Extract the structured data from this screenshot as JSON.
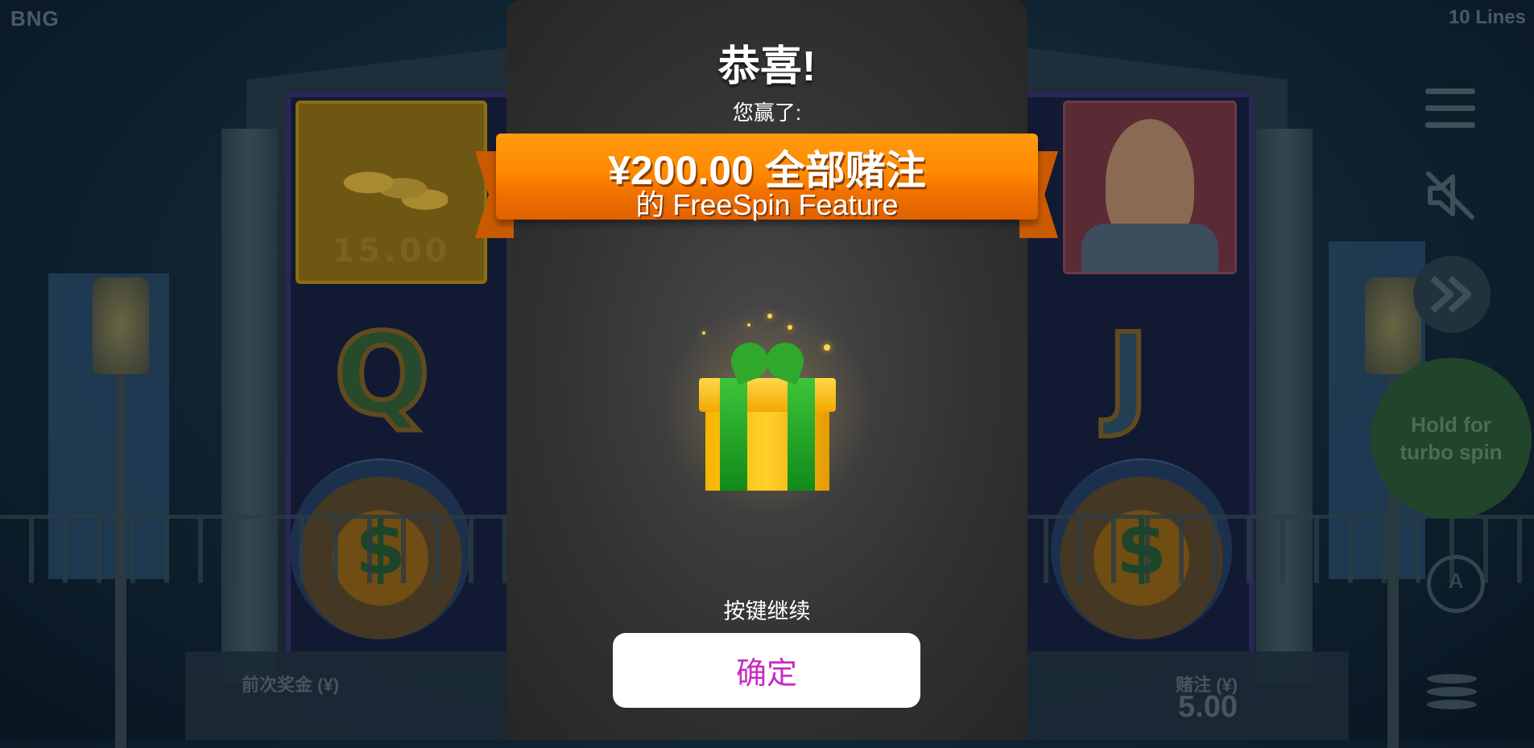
{
  "game": {
    "brand": "BNG",
    "lines_label": "10 Lines"
  },
  "reels": {
    "coin_symbol_value": "15.00",
    "letter_left": "Q",
    "letter_right": "J",
    "money_sign": "$"
  },
  "controls": {
    "spin_button_label": "Hold for turbo spin",
    "autoplay_letter": "A"
  },
  "footer": {
    "last_win_label": "前次奖金 (¥)",
    "bet_label": "赌注 (¥)",
    "bet_value": "5.00"
  },
  "modal": {
    "title": "恭喜!",
    "subtitle": "您赢了:",
    "prize_line1": "¥200.00 全部赌注",
    "prize_line2": "的 FreeSpin Feature",
    "prompt": "按键继续",
    "ok_label": "确定"
  },
  "colors": {
    "ribbon_orange": "#ff8a00",
    "ok_text_magenta": "#c62bc1",
    "modal_bg": "#333333"
  }
}
